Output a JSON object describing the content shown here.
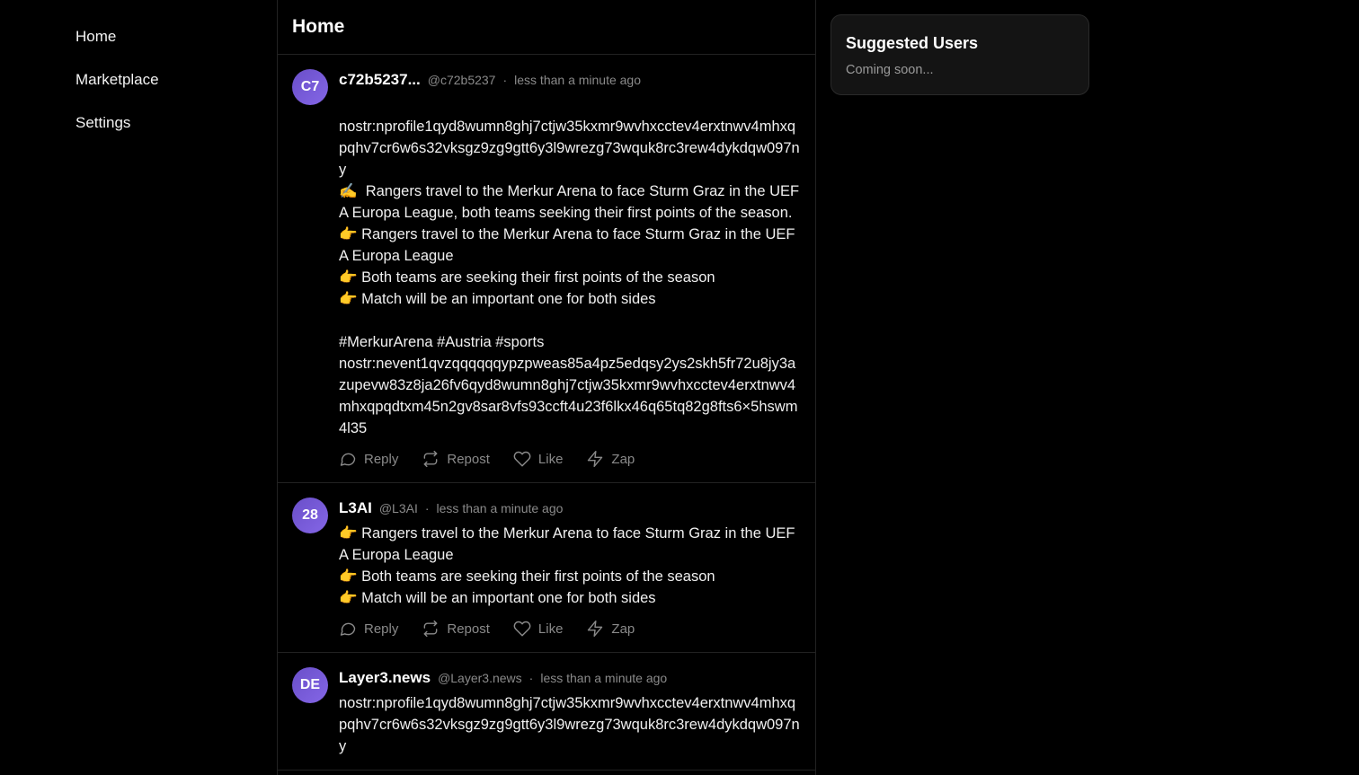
{
  "nav": {
    "items": [
      {
        "label": "Home"
      },
      {
        "label": "Marketplace"
      },
      {
        "label": "Settings"
      }
    ]
  },
  "feed": {
    "title": "Home",
    "posts": [
      {
        "avatar_initials": "C7",
        "author": "c72b5237...",
        "handle": "@c72b5237",
        "separator": "·",
        "time": "less than a minute ago",
        "content": "nostr:nprofile1qyd8wumn8ghj7ctjw35kxmr9wvhxcctev4erxtnwv4mhxqpqhv7cr6w6s32vksgz9zg9gtt6y3l9wrezg73wquk8rc3rew4dykdqw097ny\n✍️  Rangers travel to the Merkur Arena to face Sturm Graz in the UEFA Europa League, both teams seeking their first points of the season.\n👉 Rangers travel to the Merkur Arena to face Sturm Graz in the UEFA Europa League\n👉 Both teams are seeking their first points of the season\n👉 Match will be an important one for both sides\n\n#MerkurArena #Austria #sports\nnostr:nevent1qvzqqqqqqypzpweas85a4pz5edqsy2ys2skh5fr72u8jy3azupevw83z8ja26fv6qyd8wumn8ghj7ctjw35kxmr9wvhxcctev4erxtnwv4mhxqpqdtxm45n2gv8sar8vfs93ccft4u23f6lkx46q65tq82g8fts6×5hswm4l35",
        "actions": {
          "reply": "Reply",
          "repost": "Repost",
          "like": "Like",
          "zap": "Zap"
        }
      },
      {
        "avatar_initials": "28",
        "author": "L3AI",
        "handle": "@L3AI",
        "separator": "·",
        "time": "less than a minute ago",
        "content": "👉 Rangers travel to the Merkur Arena to face Sturm Graz in the UEFA Europa League\n👉 Both teams are seeking their first points of the season\n👉 Match will be an important one for both sides",
        "actions": {
          "reply": "Reply",
          "repost": "Repost",
          "like": "Like",
          "zap": "Zap"
        }
      },
      {
        "avatar_initials": "DE",
        "author": "Layer3.news",
        "handle": "@Layer3.news",
        "separator": "·",
        "time": "less than a minute ago",
        "content": "nostr:nprofile1qyd8wumn8ghj7ctjw35kxmr9wvhxcctev4erxtnwv4mhxqpqhv7cr6w6s32vksgz9zg9gtt6y3l9wrezg73wquk8rc3rew4dykdqw097ny"
      }
    ]
  },
  "suggested": {
    "title": "Suggested Users",
    "subtitle": "Coming soon..."
  },
  "colors": {
    "background": "#000000",
    "avatar_gradient_start": "#6a4fc9",
    "avatar_gradient_end": "#8466e6",
    "muted_text": "#8a8a8a",
    "card_background": "#141414"
  },
  "icons": {
    "reply": "speech-bubble-icon",
    "repost": "repost-arrows-icon",
    "like": "heart-icon",
    "zap": "lightning-icon"
  }
}
